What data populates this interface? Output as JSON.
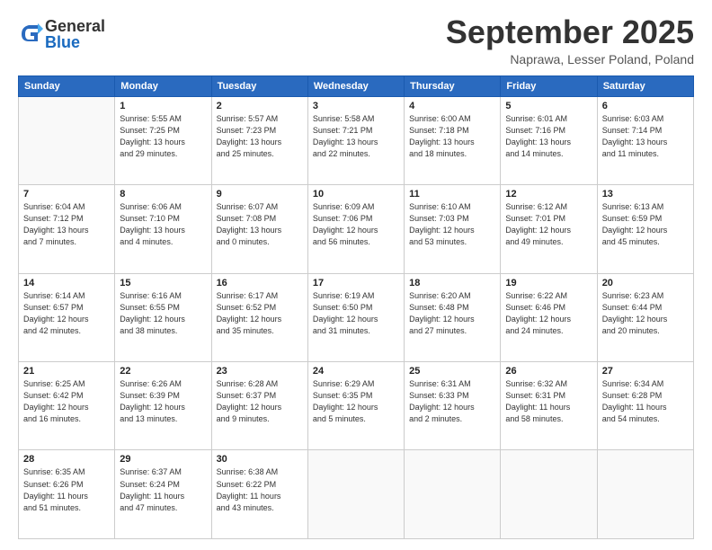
{
  "logo": {
    "general": "General",
    "blue": "Blue"
  },
  "header": {
    "month": "September 2025",
    "location": "Naprawa, Lesser Poland, Poland"
  },
  "weekdays": [
    "Sunday",
    "Monday",
    "Tuesday",
    "Wednesday",
    "Thursday",
    "Friday",
    "Saturday"
  ],
  "weeks": [
    [
      {
        "day": "",
        "info": ""
      },
      {
        "day": "1",
        "info": "Sunrise: 5:55 AM\nSunset: 7:25 PM\nDaylight: 13 hours\nand 29 minutes."
      },
      {
        "day": "2",
        "info": "Sunrise: 5:57 AM\nSunset: 7:23 PM\nDaylight: 13 hours\nand 25 minutes."
      },
      {
        "day": "3",
        "info": "Sunrise: 5:58 AM\nSunset: 7:21 PM\nDaylight: 13 hours\nand 22 minutes."
      },
      {
        "day": "4",
        "info": "Sunrise: 6:00 AM\nSunset: 7:18 PM\nDaylight: 13 hours\nand 18 minutes."
      },
      {
        "day": "5",
        "info": "Sunrise: 6:01 AM\nSunset: 7:16 PM\nDaylight: 13 hours\nand 14 minutes."
      },
      {
        "day": "6",
        "info": "Sunrise: 6:03 AM\nSunset: 7:14 PM\nDaylight: 13 hours\nand 11 minutes."
      }
    ],
    [
      {
        "day": "7",
        "info": "Sunrise: 6:04 AM\nSunset: 7:12 PM\nDaylight: 13 hours\nand 7 minutes."
      },
      {
        "day": "8",
        "info": "Sunrise: 6:06 AM\nSunset: 7:10 PM\nDaylight: 13 hours\nand 4 minutes."
      },
      {
        "day": "9",
        "info": "Sunrise: 6:07 AM\nSunset: 7:08 PM\nDaylight: 13 hours\nand 0 minutes."
      },
      {
        "day": "10",
        "info": "Sunrise: 6:09 AM\nSunset: 7:06 PM\nDaylight: 12 hours\nand 56 minutes."
      },
      {
        "day": "11",
        "info": "Sunrise: 6:10 AM\nSunset: 7:03 PM\nDaylight: 12 hours\nand 53 minutes."
      },
      {
        "day": "12",
        "info": "Sunrise: 6:12 AM\nSunset: 7:01 PM\nDaylight: 12 hours\nand 49 minutes."
      },
      {
        "day": "13",
        "info": "Sunrise: 6:13 AM\nSunset: 6:59 PM\nDaylight: 12 hours\nand 45 minutes."
      }
    ],
    [
      {
        "day": "14",
        "info": "Sunrise: 6:14 AM\nSunset: 6:57 PM\nDaylight: 12 hours\nand 42 minutes."
      },
      {
        "day": "15",
        "info": "Sunrise: 6:16 AM\nSunset: 6:55 PM\nDaylight: 12 hours\nand 38 minutes."
      },
      {
        "day": "16",
        "info": "Sunrise: 6:17 AM\nSunset: 6:52 PM\nDaylight: 12 hours\nand 35 minutes."
      },
      {
        "day": "17",
        "info": "Sunrise: 6:19 AM\nSunset: 6:50 PM\nDaylight: 12 hours\nand 31 minutes."
      },
      {
        "day": "18",
        "info": "Sunrise: 6:20 AM\nSunset: 6:48 PM\nDaylight: 12 hours\nand 27 minutes."
      },
      {
        "day": "19",
        "info": "Sunrise: 6:22 AM\nSunset: 6:46 PM\nDaylight: 12 hours\nand 24 minutes."
      },
      {
        "day": "20",
        "info": "Sunrise: 6:23 AM\nSunset: 6:44 PM\nDaylight: 12 hours\nand 20 minutes."
      }
    ],
    [
      {
        "day": "21",
        "info": "Sunrise: 6:25 AM\nSunset: 6:42 PM\nDaylight: 12 hours\nand 16 minutes."
      },
      {
        "day": "22",
        "info": "Sunrise: 6:26 AM\nSunset: 6:39 PM\nDaylight: 12 hours\nand 13 minutes."
      },
      {
        "day": "23",
        "info": "Sunrise: 6:28 AM\nSunset: 6:37 PM\nDaylight: 12 hours\nand 9 minutes."
      },
      {
        "day": "24",
        "info": "Sunrise: 6:29 AM\nSunset: 6:35 PM\nDaylight: 12 hours\nand 5 minutes."
      },
      {
        "day": "25",
        "info": "Sunrise: 6:31 AM\nSunset: 6:33 PM\nDaylight: 12 hours\nand 2 minutes."
      },
      {
        "day": "26",
        "info": "Sunrise: 6:32 AM\nSunset: 6:31 PM\nDaylight: 11 hours\nand 58 minutes."
      },
      {
        "day": "27",
        "info": "Sunrise: 6:34 AM\nSunset: 6:28 PM\nDaylight: 11 hours\nand 54 minutes."
      }
    ],
    [
      {
        "day": "28",
        "info": "Sunrise: 6:35 AM\nSunset: 6:26 PM\nDaylight: 11 hours\nand 51 minutes."
      },
      {
        "day": "29",
        "info": "Sunrise: 6:37 AM\nSunset: 6:24 PM\nDaylight: 11 hours\nand 47 minutes."
      },
      {
        "day": "30",
        "info": "Sunrise: 6:38 AM\nSunset: 6:22 PM\nDaylight: 11 hours\nand 43 minutes."
      },
      {
        "day": "",
        "info": ""
      },
      {
        "day": "",
        "info": ""
      },
      {
        "day": "",
        "info": ""
      },
      {
        "day": "",
        "info": ""
      }
    ]
  ]
}
